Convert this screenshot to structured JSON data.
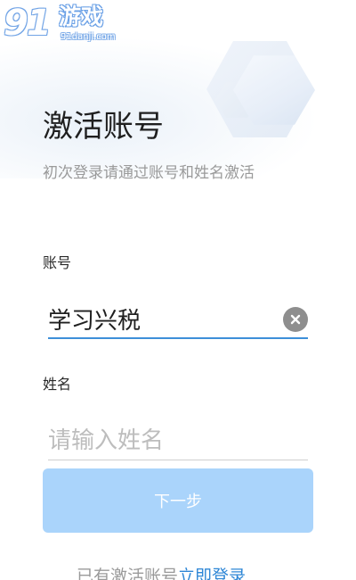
{
  "watermark": {
    "number": "91",
    "name": "游戏",
    "domain": "91danji.com"
  },
  "header": {
    "title": "激活账号",
    "subtitle": "初次登录请通过账号和姓名激活"
  },
  "form": {
    "account": {
      "label": "账号",
      "value": "学习兴税"
    },
    "name": {
      "label": "姓名",
      "value": "",
      "placeholder": "请输入姓名"
    },
    "next_label": "下一步"
  },
  "footer": {
    "prompt": "已有激活账号",
    "link": "立即登录"
  },
  "colors": {
    "accent": "#3d8fd9",
    "button_disabled": "#aad4fb",
    "link": "#2f87d6"
  }
}
